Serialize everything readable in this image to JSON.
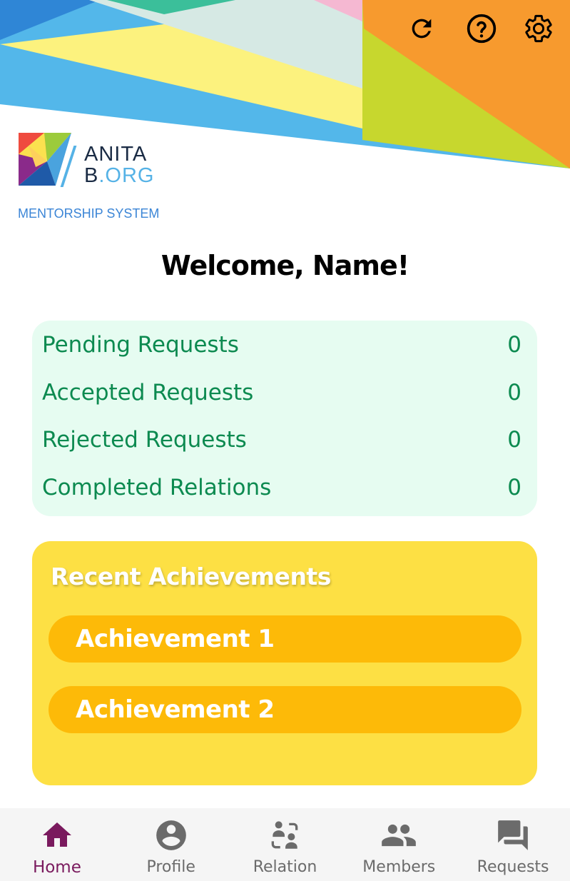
{
  "header": {
    "icons": [
      "refresh-icon",
      "help-icon",
      "settings-icon"
    ]
  },
  "logo": {
    "line1": "ANITA",
    "line2_prefix": "B",
    "line2_suffix": ".ORG",
    "subtitle": "MENTORSHIP SYSTEM"
  },
  "welcome": "Welcome, Name!",
  "stats": [
    {
      "label": "Pending Requests",
      "value": "0"
    },
    {
      "label": "Accepted Requests",
      "value": "0"
    },
    {
      "label": "Rejected Requests",
      "value": "0"
    },
    {
      "label": "Completed Relations",
      "value": "0"
    }
  ],
  "achievements": {
    "title": "Recent Achievements",
    "items": [
      "Achievement 1",
      "Achievement 2"
    ]
  },
  "nav": {
    "items": [
      {
        "label": "Home",
        "icon": "home-icon",
        "active": true
      },
      {
        "label": "Profile",
        "icon": "profile-icon",
        "active": false
      },
      {
        "label": "Relation",
        "icon": "relation-icon",
        "active": false
      },
      {
        "label": "Members",
        "icon": "members-icon",
        "active": false
      },
      {
        "label": "Requests",
        "icon": "requests-icon",
        "active": false
      }
    ]
  },
  "colors": {
    "accent": "#7a1a5e",
    "stats_bg": "#e6fcf1",
    "stats_text": "#0c8a50",
    "achievements_bg": "#fde044",
    "achievement_pill": "#fdba08",
    "subtitle": "#3b85d6"
  }
}
